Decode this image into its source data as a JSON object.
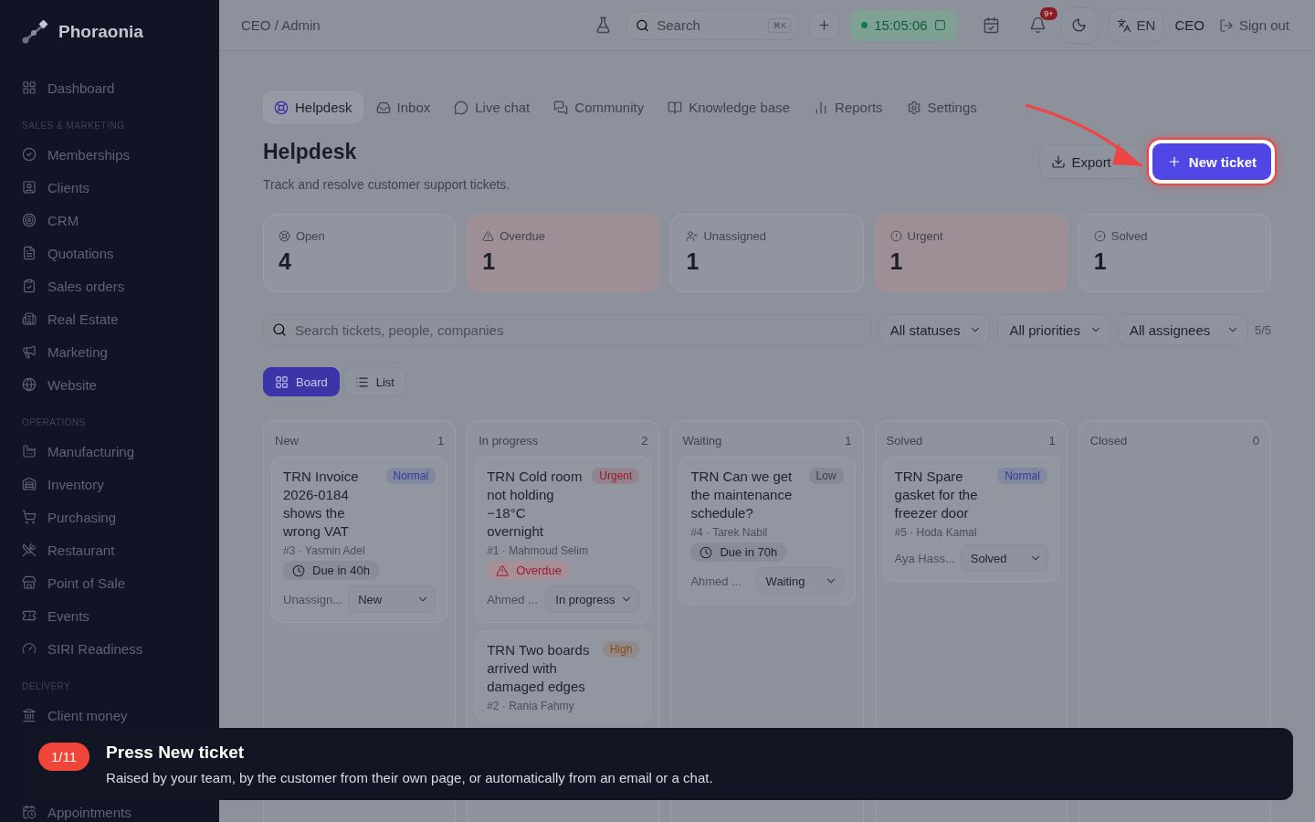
{
  "sidebar": {
    "brand": "Phoraonia",
    "sections": [
      {
        "items": [
          {
            "label": "Dashboard"
          }
        ]
      },
      {
        "heading": "SALES & MARKETING",
        "items": [
          {
            "label": "Memberships"
          },
          {
            "label": "Clients"
          },
          {
            "label": "CRM"
          },
          {
            "label": "Quotations"
          },
          {
            "label": "Sales orders"
          },
          {
            "label": "Real Estate"
          },
          {
            "label": "Marketing"
          },
          {
            "label": "Website"
          }
        ]
      },
      {
        "heading": "OPERATIONS",
        "items": [
          {
            "label": "Manufacturing"
          },
          {
            "label": "Inventory"
          },
          {
            "label": "Purchasing"
          },
          {
            "label": "Restaurant"
          },
          {
            "label": "Point of Sale"
          },
          {
            "label": "Events"
          },
          {
            "label": "SIRI Readiness"
          }
        ]
      },
      {
        "heading": "DELIVERY",
        "items": [
          {
            "label": "Client money"
          },
          {
            "label": "Appointments"
          }
        ]
      }
    ]
  },
  "topbar": {
    "breadcrumb": "CEO / Admin",
    "search": {
      "placeholder": "Search",
      "shortcut": "⌘K"
    },
    "timer": "15:05:06",
    "notifications": "9+",
    "language": "EN",
    "role": "CEO",
    "sign_out": "Sign out"
  },
  "tabs": [
    {
      "label": "Helpdesk",
      "selected": true
    },
    {
      "label": "Inbox",
      "selected": false
    },
    {
      "label": "Live chat",
      "selected": false
    },
    {
      "label": "Community",
      "selected": false
    },
    {
      "label": "Knowledge base",
      "selected": false
    },
    {
      "label": "Reports",
      "selected": false
    },
    {
      "label": "Settings",
      "selected": false
    }
  ],
  "page": {
    "title": "Helpdesk",
    "subtitle": "Track and resolve customer support tickets.",
    "export": "Export",
    "new_ticket": "New ticket"
  },
  "stats": [
    {
      "label": "Open",
      "value": "4",
      "alert": false
    },
    {
      "label": "Overdue",
      "value": "1",
      "alert": true
    },
    {
      "label": "Unassigned",
      "value": "1",
      "alert": false
    },
    {
      "label": "Urgent",
      "value": "1",
      "alert": true
    },
    {
      "label": "Solved",
      "value": "1",
      "alert": false
    }
  ],
  "filters": {
    "search": {
      "placeholder": "Search tickets, people, companies"
    },
    "selects": [
      "All statuses",
      "All priorities",
      "All assignees"
    ],
    "count": "5/5"
  },
  "views": [
    {
      "label": "Board",
      "selected": true
    },
    {
      "label": "List",
      "selected": false
    }
  ],
  "columns": [
    {
      "title": "New",
      "count": "1",
      "tickets": [
        {
          "title": "TRN Invoice 2026-0184 shows the wrong VAT",
          "priority": "Normal",
          "color": "#2a3f9a",
          "meta": "#3 · Yasmin Adel",
          "due": "Due in 40h",
          "overdue": false,
          "assignee": "Unassign...",
          "status": "New"
        }
      ]
    },
    {
      "title": "In progress",
      "count": "2",
      "tickets": [
        {
          "title": "TRN Cold room not holding −18°C overnight",
          "priority": "Urgent",
          "color": "#9b1c2e",
          "meta": "#1 · Mahmoud Selim",
          "due": "Overdue",
          "overdue": true,
          "assignee": "Ahmed ...",
          "status": "In progress"
        },
        {
          "title": "TRN Two boards arrived with damaged edges",
          "priority": "High",
          "color": "#8a4a10",
          "meta": "#2 · Rania Fahmy"
        }
      ]
    },
    {
      "title": "Waiting",
      "count": "1",
      "tickets": [
        {
          "title": "TRN Can we get the maintenance schedule?",
          "priority": "Low",
          "color": "#3c414d",
          "meta": "#4 · Tarek Nabil",
          "due": "Due in 70h",
          "overdue": false,
          "assignee": "Ahmed ...",
          "status": "Waiting"
        }
      ]
    },
    {
      "title": "Solved",
      "count": "1",
      "tickets": [
        {
          "title": "TRN Spare gasket for the freezer door",
          "priority": "Normal",
          "color": "#2a3f9a",
          "meta": "#5 · Hoda Kamal",
          "assignee": "Aya Hass...",
          "status": "Solved"
        }
      ]
    },
    {
      "title": "Closed",
      "count": "0"
    }
  ],
  "tour": {
    "step": "1/11",
    "title": "Press New ticket",
    "text": "Raised by your team, by the customer from their own page, or automatically from an email or a chat."
  }
}
